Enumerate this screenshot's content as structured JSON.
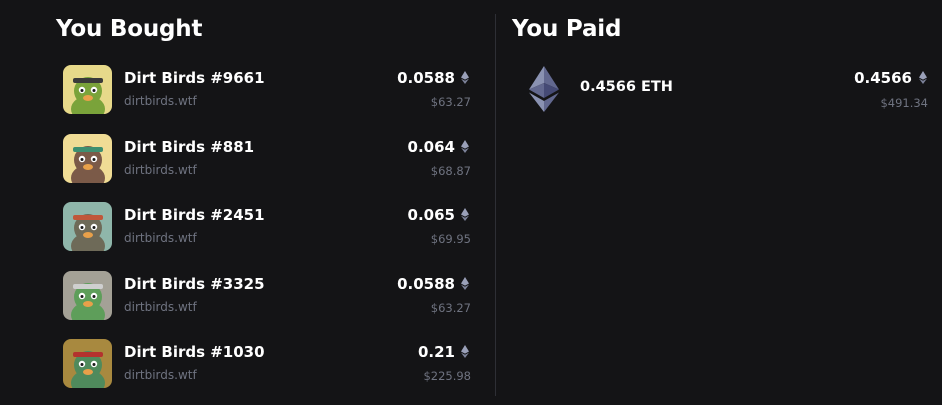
{
  "bought": {
    "title": "You Bought",
    "items": [
      {
        "name": "Dirt Birds #9661",
        "source": "dirtbirds.wtf",
        "price": "0.0588",
        "usd": "$63.27",
        "bg_color": "#e7d98a",
        "bird_color": "#7aa33a",
        "accent": "#3a3a3a"
      },
      {
        "name": "Dirt Birds #881",
        "source": "dirtbirds.wtf",
        "price": "0.064",
        "usd": "$68.87",
        "bg_color": "#f0dc95",
        "bird_color": "#7b5a48",
        "accent": "#3d8f70"
      },
      {
        "name": "Dirt Birds #2451",
        "source": "dirtbirds.wtf",
        "price": "0.065",
        "usd": "$69.95",
        "bg_color": "#8fb6aa",
        "bird_color": "#6e6a58",
        "accent": "#c0573a"
      },
      {
        "name": "Dirt Birds #3325",
        "source": "dirtbirds.wtf",
        "price": "0.0588",
        "usd": "$63.27",
        "bg_color": "#a4a196",
        "bird_color": "#5e9e5a",
        "accent": "#cfcfcf"
      },
      {
        "name": "Dirt Birds #1030",
        "source": "dirtbirds.wtf",
        "price": "0.21",
        "usd": "$225.98",
        "bg_color": "#a8893f",
        "bird_color": "#4f8a5c",
        "accent": "#b3322e"
      }
    ]
  },
  "paid": {
    "title": "You Paid",
    "label": "0.4566 ETH",
    "price": "0.4566",
    "usd": "$491.34",
    "icon": "ethereum-icon"
  },
  "colors": {
    "background": "#141416",
    "divider": "#2e2f35",
    "muted_text": "#6f7380",
    "eth_logo": "#8a92b2"
  }
}
